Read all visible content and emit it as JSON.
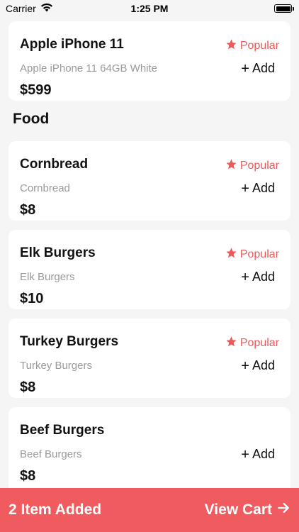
{
  "status_bar": {
    "carrier": "Carrier",
    "time": "1:25 PM"
  },
  "accent_color": "#ef5b5e",
  "items": [
    {
      "title": "Apple iPhone 11",
      "subtitle": "Apple iPhone 11 64GB White",
      "price": "$599",
      "popular": "Popular",
      "add": "Add"
    }
  ],
  "food_section": {
    "title": "Food",
    "items": [
      {
        "title": "Cornbread",
        "subtitle": "Cornbread",
        "price": "$8",
        "popular": "Popular",
        "add": "Add"
      },
      {
        "title": "Elk Burgers",
        "subtitle": "Elk Burgers",
        "price": "$10",
        "popular": "Popular",
        "add": "Add"
      },
      {
        "title": "Turkey Burgers",
        "subtitle": "Turkey Burgers",
        "price": "$8",
        "popular": "Popular",
        "add": "Add"
      },
      {
        "title": "Beef Burgers",
        "subtitle": "Beef Burgers",
        "price": "$8",
        "popular": null,
        "add": "Add"
      }
    ]
  },
  "cart_bar": {
    "items_added": "2 Item Added",
    "view_cart": "View Cart"
  }
}
